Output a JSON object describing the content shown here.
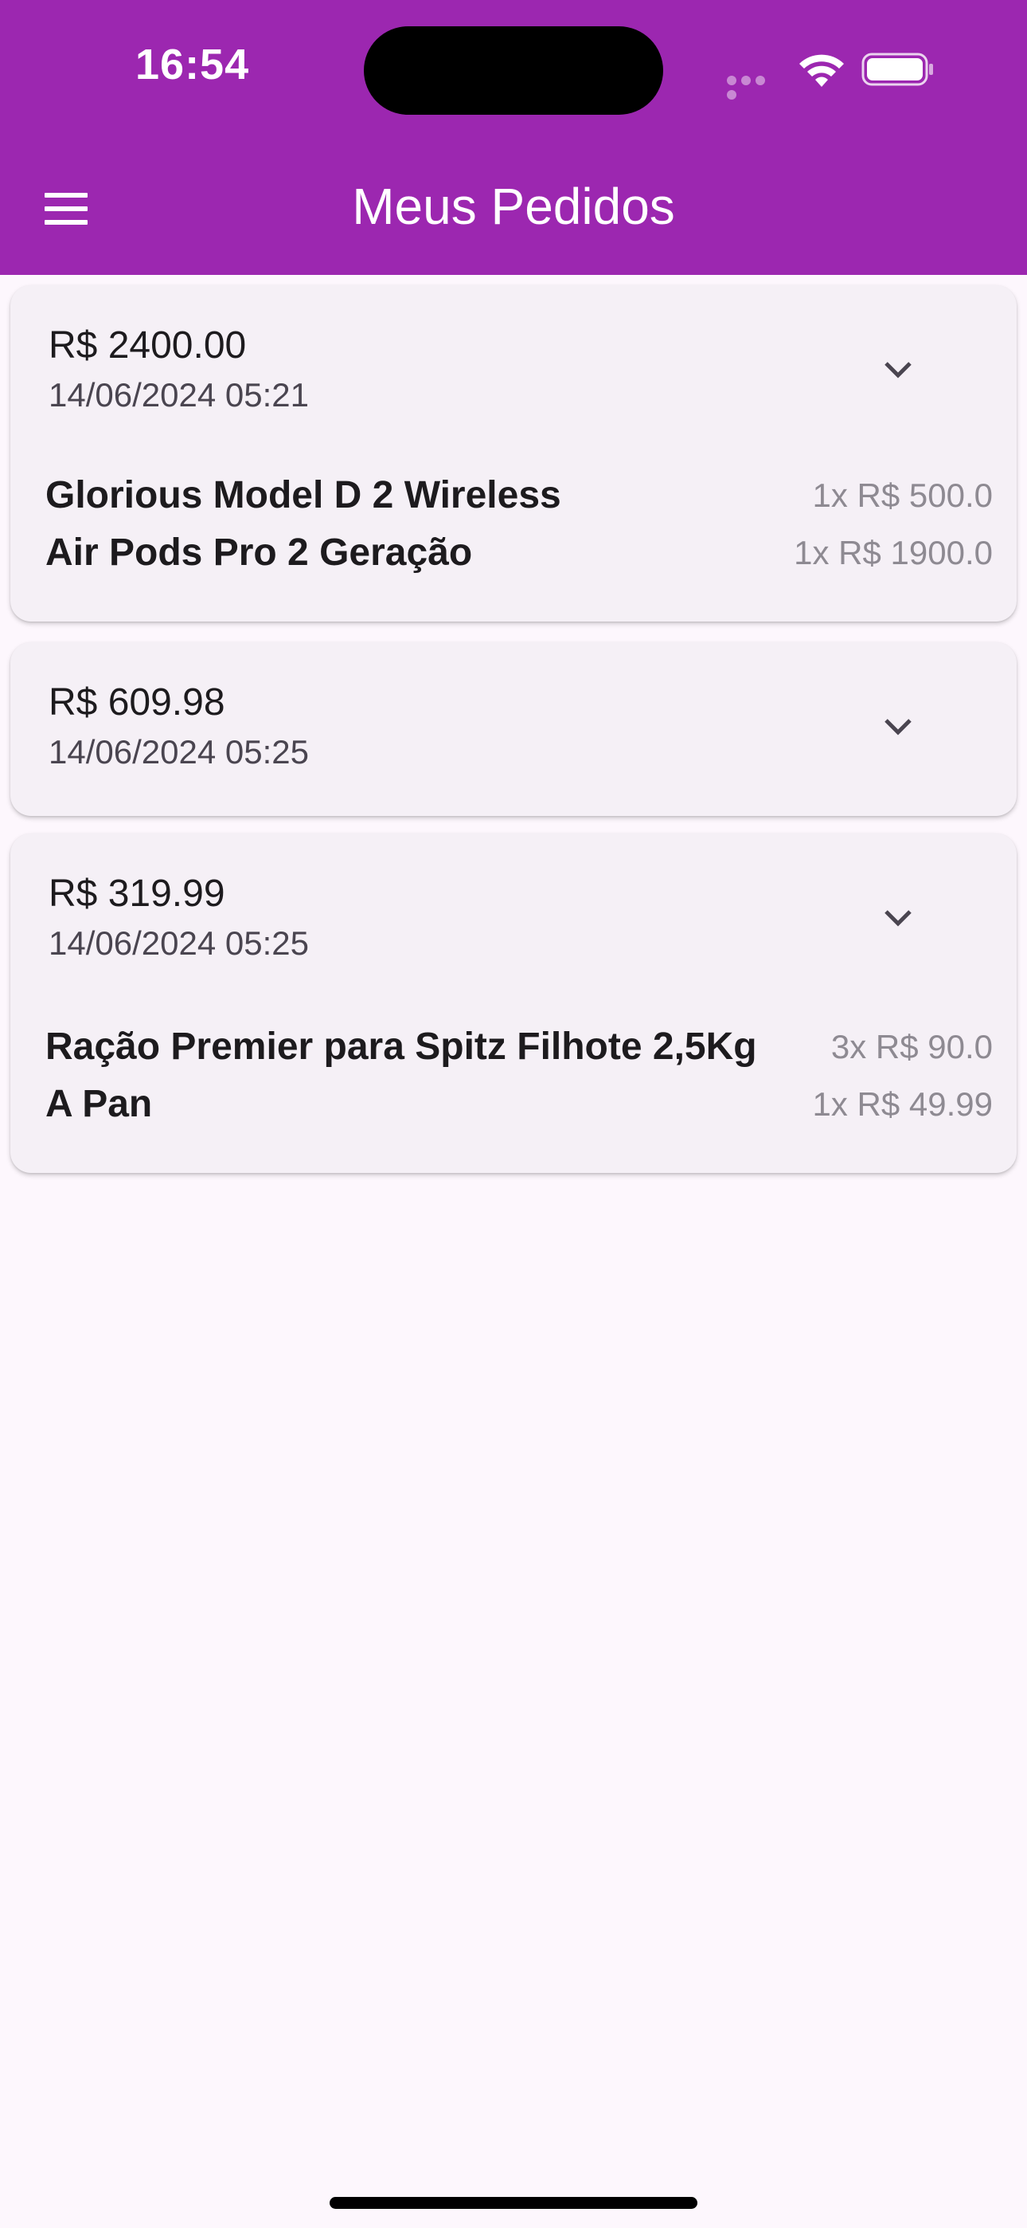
{
  "status_bar": {
    "time": "16:54"
  },
  "header": {
    "title": "Meus Pedidos",
    "menu_icon": "hamburger-menu-icon"
  },
  "orders": [
    {
      "total": "R$ 2400.00",
      "date": "14/06/2024 05:21",
      "expanded": true,
      "items": [
        {
          "name": "Glorious Model D 2 Wireless",
          "qty_price": "1x R$ 500.0"
        },
        {
          "name": "Air Pods Pro 2 Geração",
          "qty_price": "1x R$ 1900.0"
        }
      ]
    },
    {
      "total": "R$ 609.98",
      "date": "14/06/2024 05:25",
      "expanded": false,
      "items": []
    },
    {
      "total": "R$ 319.99",
      "date": "14/06/2024 05:25",
      "expanded": true,
      "items": [
        {
          "name": "Ração Premier para Spitz Filhote 2,5Kg",
          "qty_price": "3x R$ 90.0"
        },
        {
          "name": "A Pan",
          "qty_price": "1x R$ 49.99"
        }
      ]
    }
  ],
  "colors": {
    "app_bar": "#9c27b0",
    "background": "#fdf7fd",
    "card": "#f5f0f6"
  }
}
